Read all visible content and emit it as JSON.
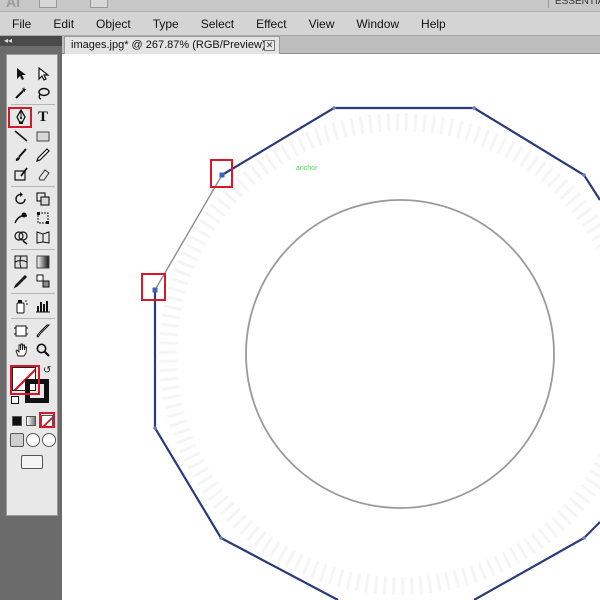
{
  "app": {
    "logo_text": "Ai",
    "workspace_label": "ESSENTIALS"
  },
  "menubar": {
    "items": [
      "File",
      "Edit",
      "Object",
      "Type",
      "Select",
      "Effect",
      "View",
      "Window",
      "Help"
    ]
  },
  "tools_panel": {
    "collapse_glyph": "◂◂",
    "type_tool_label": "T",
    "fill_stroke": {
      "fill": "none",
      "stroke": "#111111"
    }
  },
  "document": {
    "tab_title": "images.jpg* @ 267.87% (RGB/Preview)",
    "close_glyph": "✕"
  },
  "canvas": {
    "anchor_hint": "anchor",
    "colors": {
      "path_stroke": "#2b3a7a",
      "segment_in_progress": "#8f8f8f",
      "inner_circle": "#9a9a9a",
      "highlight": "#d7182a",
      "hint_text": "#59d15c"
    },
    "highlighted_items": [
      "pen-tool",
      "anchor-point-top",
      "anchor-point-left",
      "fill-stroke-swatch",
      "none-swatch"
    ]
  }
}
